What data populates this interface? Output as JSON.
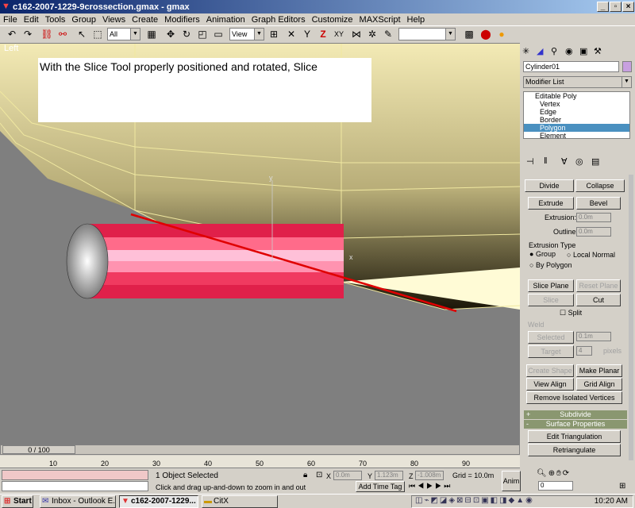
{
  "window": {
    "title": "c162-2007-1229-9crossection.gmax - gmax",
    "min": "_",
    "restore": "▫",
    "close": "×"
  },
  "menu": [
    "File",
    "Edit",
    "Tools",
    "Group",
    "Views",
    "Create",
    "Modifiers",
    "Animation",
    "Graph Editors",
    "Customize",
    "MAXScript",
    "Help"
  ],
  "toolbar": {
    "selection_filter": "All",
    "ref_coord": "View"
  },
  "viewport": {
    "label": "Left",
    "annotation": "With the Slice Tool properly positioned and rotated, Slice",
    "axis_y": "y",
    "axis_x": "x"
  },
  "command_panel": {
    "object_name": "Cylinder01",
    "object_color": "#c8a0e0",
    "modifier_list": "Modifier List",
    "stack": [
      "Editable Poly",
      "Vertex",
      "Edge",
      "Border",
      "Polygon",
      "Element"
    ],
    "stack_selected": "Polygon",
    "divide": "Divide",
    "collapse": "Collapse",
    "extrude": "Extrude",
    "bevel": "Bevel",
    "extrusion_label": "Extrusion:",
    "extrusion_value": "0.0m",
    "outline_label": "Outline",
    "outline_value": "0.0m",
    "extrusion_type": "Extrusion Type",
    "group": "Group",
    "local_normal": "Local Normal",
    "by_polygon": "By Polygon",
    "slice_plane": "Slice Plane",
    "reset_plane": "Reset Plane",
    "slice": "Slice",
    "cut": "Cut",
    "split": "Split",
    "weld": "Weld",
    "selected": "Selected",
    "selected_value": "0.1m",
    "target": "Target",
    "target_value": "4",
    "pixels": "pixels",
    "create_shape": "Create Shape",
    "make_planar": "Make Planar",
    "view_align": "View Align",
    "grid_align": "Grid Align",
    "remove_isolated": "Remove Isolated Vertices",
    "subdivide": "Subdivide",
    "subdivide_sign": "+",
    "surface_props": "Surface Properties",
    "surface_sign": "-",
    "edit_triangulation": "Edit Triangulation",
    "retriangulate": "Retriangulate"
  },
  "timeline": {
    "slider": "0 / 100",
    "ticks": [
      "10",
      "20",
      "30",
      "40",
      "50",
      "60",
      "70",
      "80",
      "90"
    ]
  },
  "status": {
    "selected": "1 Object Selected",
    "prompt": "Click and drag up-and-down to zoom in and out",
    "x_label": "X",
    "x_value": "0.0m",
    "y_label": "Y",
    "y_value": "1.123m",
    "z_label": "Z",
    "z_value": "-1.008m",
    "grid": "Grid = 10.0m",
    "add_time_tag": "Add Time Tag",
    "anim": "Anim",
    "frame": "0"
  },
  "taskbar": {
    "start": "Start",
    "tasks": [
      "Inbox - Outlook E...",
      "c162-2007-1229...",
      "CitX"
    ],
    "clock": "10:20 AM"
  }
}
